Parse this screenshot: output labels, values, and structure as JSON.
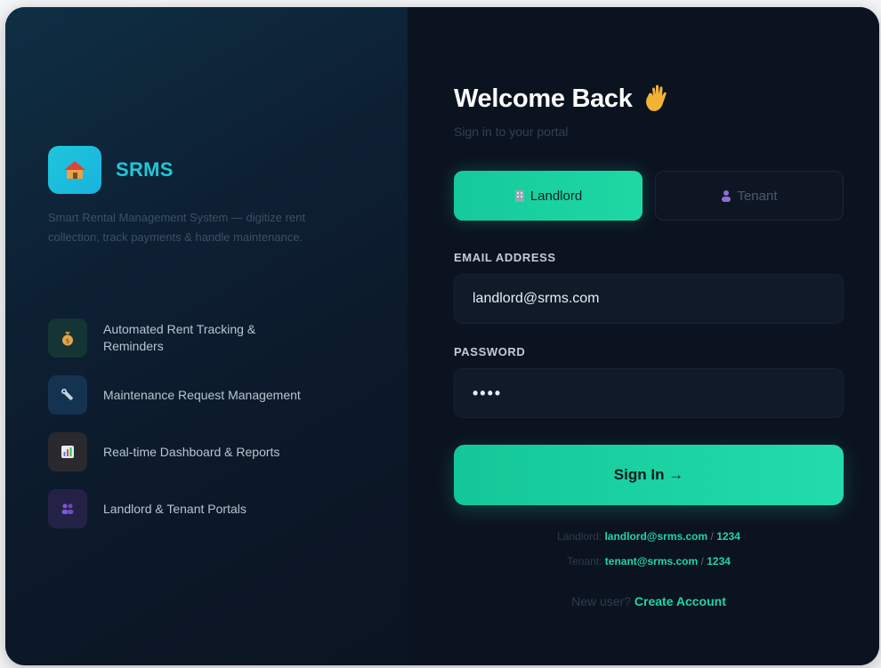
{
  "brand": {
    "name": "SRMS",
    "tagline": "Smart Rental Management System — digitize rent collection, track payments & handle maintenance."
  },
  "features": [
    {
      "icon": "money-bag-icon",
      "label": "Automated Rent Tracking & Reminders"
    },
    {
      "icon": "wrench-icon",
      "label": "Maintenance Request Management"
    },
    {
      "icon": "bar-chart-icon",
      "label": "Real-time Dashboard & Reports"
    },
    {
      "icon": "people-icon",
      "label": "Landlord & Tenant Portals"
    }
  ],
  "login": {
    "title": "Welcome Back",
    "subtitle": "Sign in to your portal",
    "roles": [
      {
        "label": "Landlord",
        "active": true
      },
      {
        "label": "Tenant",
        "active": false
      }
    ],
    "email_label": "EMAIL ADDRESS",
    "email_value": "landlord@srms.com",
    "password_label": "PASSWORD",
    "password_value": "••••",
    "signin_label": "Sign In →",
    "demo": {
      "landlord_prefix": "Landlord:",
      "landlord_email": "landlord@srms.com",
      "landlord_pass": "1234",
      "tenant_prefix": "Tenant:",
      "tenant_email": "tenant@srms.com",
      "tenant_pass": "1234",
      "separator": "/"
    },
    "new_user_prefix": "New user?",
    "create_account": "Create Account"
  },
  "colors": {
    "accent": "#1ED9A4",
    "brand": "#22C7D6",
    "background": "#0C1320"
  }
}
